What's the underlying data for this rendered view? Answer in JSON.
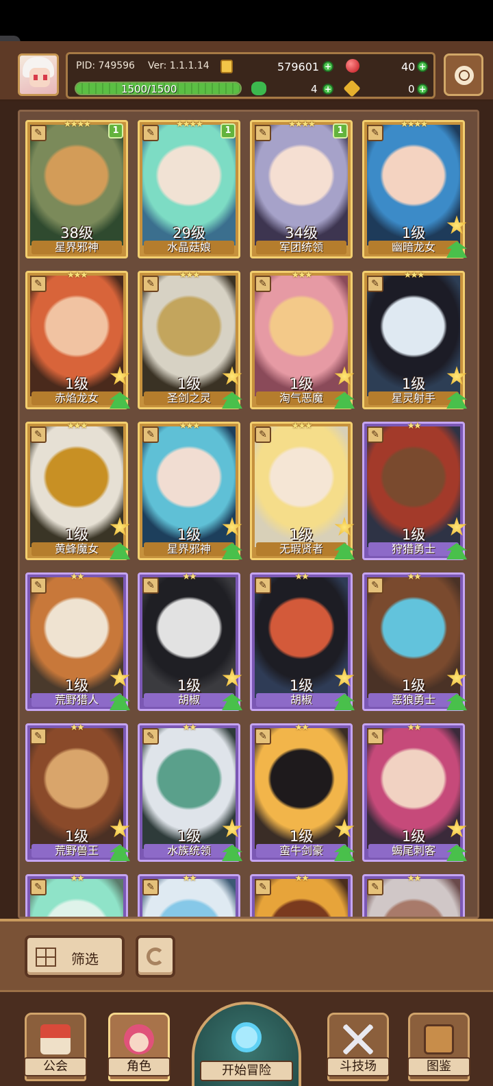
{
  "header": {
    "pid": "PID: 749596",
    "version": "Ver: 1.1.1.14",
    "gold": "579601",
    "gems": "40",
    "stamina": "1500/1500",
    "stamina_fraction": 1.0,
    "clover": "4",
    "keys": "0",
    "icons": {
      "gold": "gold-coin-icon",
      "gems": "red-gem-icon",
      "clover": "clover-icon",
      "keys": "key-icon",
      "settings": "gear-icon"
    }
  },
  "cards": [
    {
      "stars": "★★★★",
      "level": "38级",
      "name": "星界邪神",
      "rarity": "gold",
      "badge": "1",
      "upgradable": false,
      "palette": [
        "#2f4a2f",
        "#7b8a5a",
        "#d39c58"
      ]
    },
    {
      "stars": "★★★★",
      "level": "29级",
      "name": "水晶菇娘",
      "rarity": "gold",
      "badge": "1",
      "upgradable": false,
      "palette": [
        "#3b6f8e",
        "#7ddcc4",
        "#f1e2d4"
      ]
    },
    {
      "stars": "★★★★",
      "level": "34级",
      "name": "军团统领",
      "rarity": "gold",
      "badge": "1",
      "upgradable": false,
      "palette": [
        "#3d3550",
        "#a6a2c9",
        "#f5dfd2"
      ]
    },
    {
      "stars": "★★★★",
      "level": "1级",
      "name": "幽暗龙女",
      "rarity": "gold",
      "badge": "",
      "upgradable": true,
      "palette": [
        "#1e3b5a",
        "#3c8bc8",
        "#f4d3c1"
      ]
    },
    {
      "stars": "★★★",
      "level": "1级",
      "name": "赤焰龙女",
      "rarity": "gold",
      "badge": "",
      "upgradable": true,
      "palette": [
        "#4a2a1c",
        "#d8643a",
        "#f1c3a2"
      ]
    },
    {
      "stars": "★★★",
      "level": "1级",
      "name": "圣剑之灵",
      "rarity": "gold",
      "badge": "",
      "upgradable": true,
      "palette": [
        "#3a3224",
        "#d7d2c4",
        "#c3a55d"
      ]
    },
    {
      "stars": "★★★",
      "level": "1级",
      "name": "淘气恶魔",
      "rarity": "gold",
      "badge": "",
      "upgradable": true,
      "palette": [
        "#8a4a59",
        "#e69aa4",
        "#f3c989"
      ]
    },
    {
      "stars": "★★★",
      "level": "1级",
      "name": "星灵射手",
      "rarity": "gold",
      "badge": "",
      "upgradable": true,
      "palette": [
        "#2d3e55",
        "#1c1c26",
        "#dfe9f2"
      ]
    },
    {
      "stars": "★★★",
      "level": "1级",
      "name": "黄蜂魔女",
      "rarity": "gold",
      "badge": "",
      "upgradable": true,
      "palette": [
        "#3a3526",
        "#e6e0d4",
        "#c89024"
      ]
    },
    {
      "stars": "★★★",
      "level": "1级",
      "name": "星界邪神",
      "rarity": "gold",
      "badge": "",
      "upgradable": true,
      "palette": [
        "#1d3f5c",
        "#5fc0d6",
        "#f1ddd2"
      ]
    },
    {
      "stars": "★★★",
      "level": "1级",
      "name": "无瑕贤者",
      "rarity": "gold",
      "badge": "",
      "upgradable": true,
      "palette": [
        "#d8d0b8",
        "#f5dd8a",
        "#f5e6d5"
      ]
    },
    {
      "stars": "★★",
      "level": "1级",
      "name": "狩猎勇士",
      "rarity": "purple",
      "badge": "",
      "upgradable": true,
      "palette": [
        "#2e3345",
        "#a33a2a",
        "#7a4a2e"
      ]
    },
    {
      "stars": "★★",
      "level": "1级",
      "name": "荒野猎人",
      "rarity": "purple",
      "badge": "",
      "upgradable": true,
      "palette": [
        "#4a3a2c",
        "#c8783a",
        "#efe3d1"
      ]
    },
    {
      "stars": "★★",
      "level": "1级",
      "name": "胡椒",
      "rarity": "purple",
      "badge": "",
      "upgradable": true,
      "palette": [
        "#3b3b3f",
        "#1f1f24",
        "#e2e2e2"
      ]
    },
    {
      "stars": "★★",
      "level": "1级",
      "name": "胡椒",
      "rarity": "purple",
      "badge": "",
      "upgradable": true,
      "palette": [
        "#2f3c56",
        "#1d1d24",
        "#d35a3a"
      ]
    },
    {
      "stars": "★★",
      "level": "1级",
      "name": "恶狼勇士",
      "rarity": "purple",
      "badge": "",
      "upgradable": true,
      "palette": [
        "#4a3226",
        "#7a4a2e",
        "#62c3dc"
      ]
    },
    {
      "stars": "★★",
      "level": "1级",
      "name": "荒野兽王",
      "rarity": "purple",
      "badge": "",
      "upgradable": true,
      "palette": [
        "#4a3024",
        "#8a4a2a",
        "#d9a56b"
      ]
    },
    {
      "stars": "★★",
      "level": "1级",
      "name": "水族统领",
      "rarity": "purple",
      "badge": "",
      "upgradable": true,
      "palette": [
        "#2e3b3a",
        "#dfe4ea",
        "#5aa08b"
      ]
    },
    {
      "stars": "★★",
      "level": "1级",
      "name": "蛮牛剑豪",
      "rarity": "purple",
      "badge": "",
      "upgradable": true,
      "palette": [
        "#3a2d26",
        "#f2b54a",
        "#1e1a1c"
      ]
    },
    {
      "stars": "★★",
      "level": "1级",
      "name": "蝎尾刺客",
      "rarity": "purple",
      "badge": "",
      "upgradable": true,
      "palette": [
        "#3a2a3a",
        "#c64a7a",
        "#f1d2c2"
      ]
    },
    {
      "stars": "★★",
      "level": "",
      "name": "",
      "rarity": "purple",
      "badge": "",
      "upgradable": false,
      "palette": [
        "#5a7a6a",
        "#8fe3c8",
        "#dff3ea"
      ]
    },
    {
      "stars": "★★",
      "level": "",
      "name": "",
      "rarity": "purple",
      "badge": "",
      "upgradable": false,
      "palette": [
        "#3d5a74",
        "#dfeaf2",
        "#86c8e8"
      ]
    },
    {
      "stars": "★★",
      "level": "",
      "name": "",
      "rarity": "purple",
      "badge": "",
      "upgradable": false,
      "palette": [
        "#4a2e1e",
        "#e7a43a",
        "#7a3a1e"
      ]
    },
    {
      "stars": "★★",
      "level": "",
      "name": "",
      "rarity": "purple",
      "badge": "",
      "upgradable": false,
      "palette": [
        "#6a4a4a",
        "#d0c7c7",
        "#a87a6a"
      ]
    }
  ],
  "controls": {
    "filter_label": "筛选",
    "filter_icon": "grid-icon",
    "reset_icon": "refresh-icon"
  },
  "nav": {
    "guild": "公会",
    "characters": "角色",
    "adventure": "开始冒险",
    "arena": "斗技场",
    "codex": "图鉴"
  }
}
